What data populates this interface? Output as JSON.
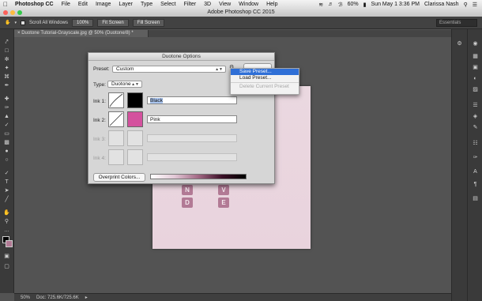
{
  "menubar": {
    "apple": "",
    "app_name": "Photoshop CC",
    "items": [
      "File",
      "Edit",
      "Image",
      "Layer",
      "Type",
      "Select",
      "Filter",
      "3D",
      "View",
      "Window",
      "Help"
    ],
    "battery": "60%",
    "clock": "Sun May 1  3:36 PM",
    "user": "Clarissa Nash"
  },
  "window": {
    "title": "Adobe Photoshop CC 2015"
  },
  "options_bar": {
    "scroll_all_label": "Scroll All Windows",
    "zoom_100": "100%",
    "fit_screen": "Fit Screen",
    "fill_screen": "Fill Screen",
    "workspace": "Essentials"
  },
  "document": {
    "tab_title": "Duotone Tutorial-Grayscale.jpg @ 50% (Duotone/8) *",
    "tiles": [
      "N",
      "V",
      "D",
      "E"
    ]
  },
  "status": {
    "zoom": "50%",
    "doc_size": "Doc: 725.6K/725.6K"
  },
  "dialog": {
    "title": "Duotone Options",
    "preset_label": "Preset:",
    "preset_value": "Custom",
    "type_label": "Type:",
    "type_value": "Duotone",
    "inks": [
      {
        "label": "Ink 1:",
        "name": "Black",
        "color": "#000000"
      },
      {
        "label": "Ink 2:",
        "name": "Pink",
        "color": "#d4519e"
      },
      {
        "label": "Ink 3:",
        "name": "",
        "color": ""
      },
      {
        "label": "Ink 4:",
        "name": "",
        "color": ""
      }
    ],
    "overprint_label": "Overprint Colors..."
  },
  "preset_menu": {
    "items": [
      "Save Preset...",
      "Load Preset...",
      "Delete Current Preset"
    ]
  },
  "colors": {
    "accent": "#2f6fd6",
    "pink_ink": "#d4519e"
  }
}
